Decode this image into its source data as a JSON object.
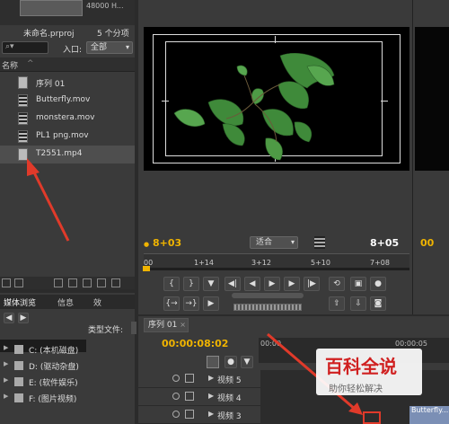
{
  "project_panel": {
    "thumb_info": "48000 H...",
    "project_name": "未命名.prproj",
    "item_count": "5 个分项",
    "search_placeholder": "",
    "entry_label": "入口:",
    "entry_value": "全部",
    "col_name": "名称",
    "items": [
      {
        "label": "序列 01",
        "icon": "sequence-icon"
      },
      {
        "label": "Butterfly.mov",
        "icon": "film-icon"
      },
      {
        "label": "monstera.mov",
        "icon": "film-icon"
      },
      {
        "label": "PL1 png.mov",
        "icon": "film-icon"
      },
      {
        "label": "T2551.mp4",
        "icon": "audio-video-icon"
      }
    ]
  },
  "program_monitor": {
    "timecode_current": "8+03",
    "fit_value": "适合",
    "timecode_duration": "8+05",
    "ruler_labels": [
      "00",
      "1+14",
      "3+12",
      "5+10",
      "7+08"
    ],
    "far_timecode": "00"
  },
  "media_browser": {
    "tabs": [
      "媒体浏览",
      "信息",
      "效"
    ],
    "type_label": "类型文件:",
    "drives": [
      {
        "label": "C: (本机磁盘)"
      },
      {
        "label": "D: (驱动杂盘)"
      },
      {
        "label": "E: (软件娱乐)"
      },
      {
        "label": "F: (图片视频)"
      }
    ]
  },
  "timeline": {
    "tab_label": "序列 01",
    "timecode": "00:00:08:02",
    "ruler_tc1": "00:00",
    "ruler_tc2": "00:00:05",
    "tracks": [
      {
        "label": "视频 5"
      },
      {
        "label": "视频 4"
      },
      {
        "label": "视频 3"
      }
    ],
    "clip_label": "Butterfly..."
  },
  "watermark": {
    "title": "百科全说",
    "subtitle": "助你轻松解决"
  },
  "colors": {
    "accent_timecode": "#f0b400",
    "annotation_red": "#e03a2a"
  }
}
